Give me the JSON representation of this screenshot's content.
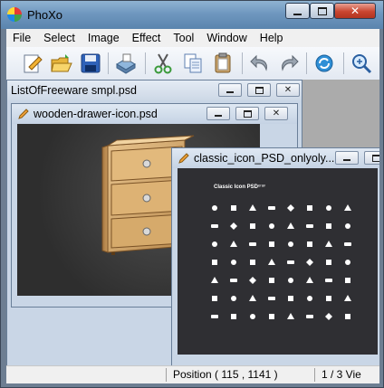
{
  "app": {
    "title": "PhoXo"
  },
  "menu": [
    "File",
    "Select",
    "Image",
    "Effect",
    "Tool",
    "Window",
    "Help"
  ],
  "toolbar": {
    "buttons": [
      "new-icon",
      "open-icon",
      "save-icon",
      "scan-icon",
      "cut-icon",
      "copy-icon",
      "paste-icon",
      "undo-icon",
      "redo-icon",
      "refresh-icon",
      "zoom-icon"
    ]
  },
  "windows": {
    "list": {
      "title": "ListOfFreeware smpl.psd"
    },
    "drawer": {
      "title": "wooden-drawer-icon.psd"
    },
    "classic": {
      "title": "classic_icon_PSD_onlyoly....",
      "heading": "Classic Icon PSD",
      "heading_suffix": "ᵉʳᵃᵛ"
    }
  },
  "status": {
    "position": "Position ( 115 , 1141 )",
    "page": "1 / 3 Vie"
  }
}
